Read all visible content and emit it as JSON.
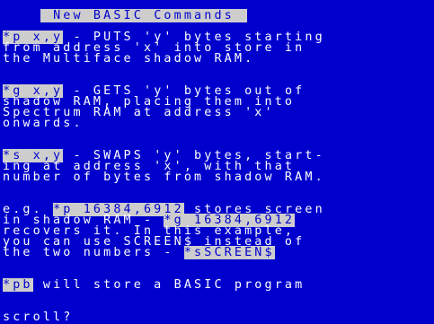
{
  "screen": {
    "title": " New BASIC Commands ",
    "put_cmd": "*p x,y",
    "put_line1": " - PUTS 'y' bytes starting",
    "put_line2": "from address 'x' into store in",
    "put_line3": "the Multiface shadow RAM.",
    "get_cmd": "*g x,y",
    "get_line1": " - GETS 'y' bytes out of",
    "get_line2": "shadow RAM, placing them into",
    "get_line3": "Spectrum RAM at address 'x'",
    "get_line4": "onwards.",
    "swap_cmd": "*s x,y",
    "swap_line1": " - SWAPS 'y' bytes, start-",
    "swap_line2": "ing at address 'x', with that",
    "swap_line3": "number of bytes from shadow RAM.",
    "eg_pre": "e.g. ",
    "eg_cmd1": "*p 16384,6912",
    "eg_post1": " stores screen",
    "eg_line2_pre": "in shadow RAM - ",
    "eg_cmd2": "*g 16384,6912",
    "eg_line3": "recovers it. In this example,",
    "eg_line4": "you can use SCREEN$ instead of",
    "eg_line5_pre": "the two numbers - ",
    "eg_cmd3": "*sSCREEN$",
    "pb_cmd": "*pb",
    "pb_text": " will store a BASIC program",
    "scroll_prompt": "scroll?"
  },
  "colors": {
    "paper": "#0000cd",
    "ink": "#ffffff",
    "inverse_paper": "#cdcdcd",
    "inverse_ink": "#0000cd"
  }
}
